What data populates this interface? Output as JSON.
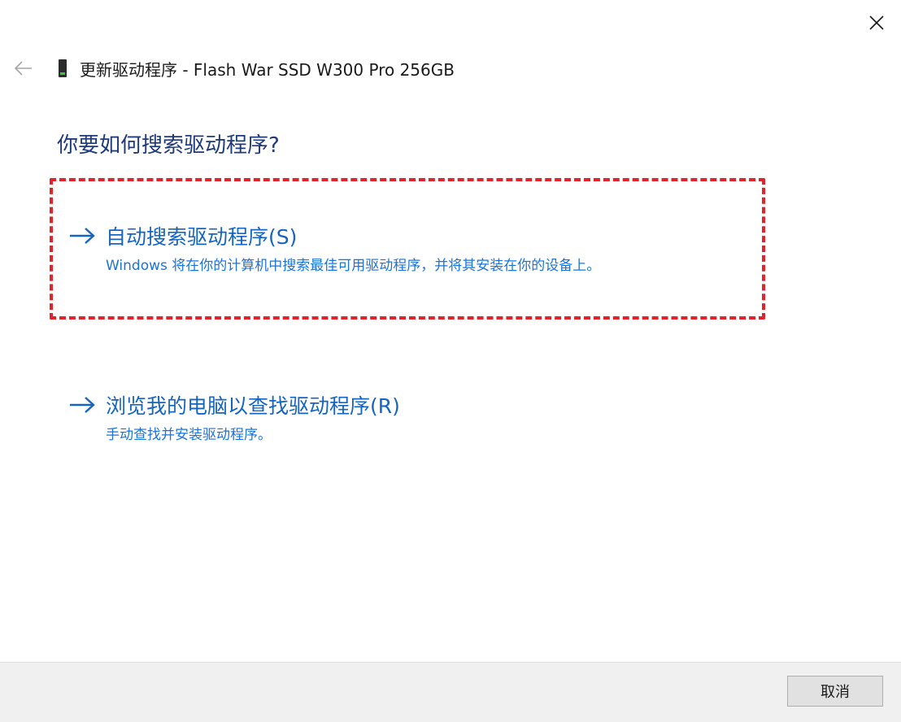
{
  "window": {
    "close_icon": "close-icon"
  },
  "header": {
    "back_icon": "back-arrow-icon",
    "device_icon": "drive-icon",
    "title": "更新驱动程序 - Flash War SSD W300 Pro 256GB"
  },
  "main": {
    "question": "你要如何搜索驱动程序?",
    "options": [
      {
        "icon": "arrow-right-icon",
        "label": "自动搜索驱动程序(S)",
        "description": "Windows 将在你的计算机中搜索最佳可用驱动程序，并将其安装在你的设备上。",
        "highlighted": true
      },
      {
        "icon": "arrow-right-icon",
        "label": "浏览我的电脑以查找驱动程序(R)",
        "description": "手动查找并安装驱动程序。",
        "highlighted": false
      }
    ]
  },
  "footer": {
    "cancel_label": "取消"
  },
  "colors": {
    "question": "#1e3a7b",
    "option_label": "#1565c0",
    "option_desc": "#1a73d9",
    "highlight_border": "#e0242b",
    "footer_bg": "#f0f0f0"
  }
}
